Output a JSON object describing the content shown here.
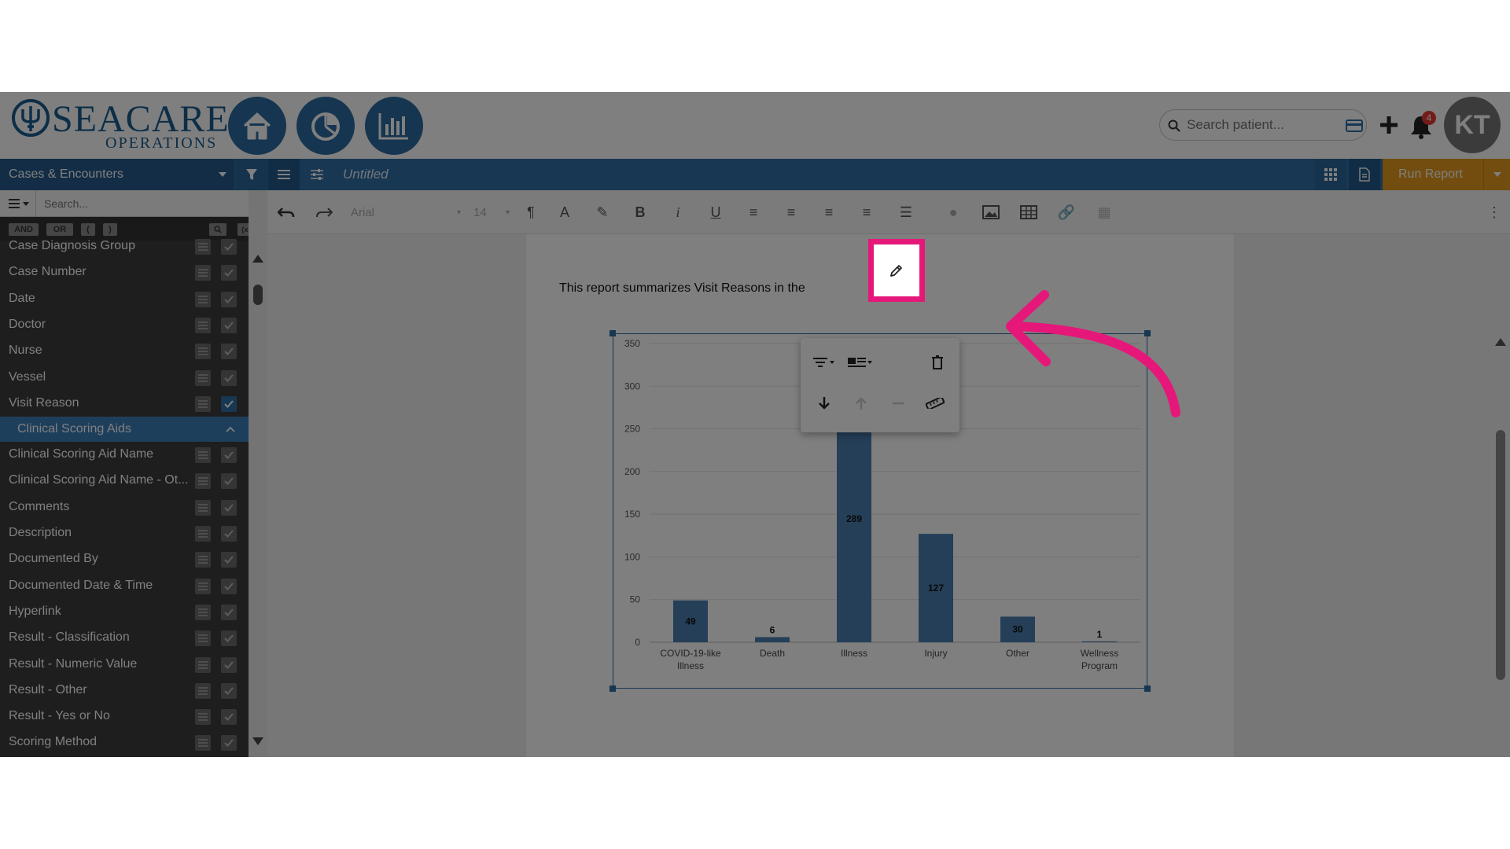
{
  "header": {
    "logo_main": "SEACARE",
    "logo_sub": "OPERATIONS",
    "nav": [
      "home-icon",
      "pie-chart-icon",
      "bar-chart-icon"
    ],
    "search_placeholder": "Search patient...",
    "notification_count": "4",
    "avatar_initials": "KT"
  },
  "toolbar": {
    "dataset_label": "Cases & Encounters",
    "document_title": "Untitled",
    "run_report_label": "Run Report",
    "font_name": "Arial",
    "font_size": "14"
  },
  "sidebar": {
    "search_placeholder": "Search...",
    "operators": [
      "AND",
      "OR",
      "(",
      ")"
    ],
    "fields_top": [
      {
        "label": "Case Diagnosis Group",
        "checked": false
      },
      {
        "label": "Case Number",
        "checked": false
      },
      {
        "label": "Date",
        "checked": false
      },
      {
        "label": "Doctor",
        "checked": false
      },
      {
        "label": "Nurse",
        "checked": false
      },
      {
        "label": "Vessel",
        "checked": false
      },
      {
        "label": "Visit Reason",
        "checked": true
      }
    ],
    "section_label": "Clinical Scoring Aids",
    "fields_section": [
      {
        "label": "Clinical Scoring Aid Name",
        "checked": false
      },
      {
        "label": "Clinical Scoring Aid Name - Ot...",
        "checked": false
      },
      {
        "label": "Comments",
        "checked": false
      },
      {
        "label": "Description",
        "checked": false
      },
      {
        "label": "Documented By",
        "checked": false
      },
      {
        "label": "Documented Date & Time",
        "checked": false
      },
      {
        "label": "Hyperlink",
        "checked": false
      },
      {
        "label": "Result - Classification",
        "checked": false
      },
      {
        "label": "Result - Numeric Value",
        "checked": false
      },
      {
        "label": "Result - Other",
        "checked": false
      },
      {
        "label": "Result - Yes or No",
        "checked": false
      },
      {
        "label": "Scoring Method",
        "checked": false
      }
    ]
  },
  "document": {
    "intro_text": "This report summarizes Visit Reasons in the"
  },
  "chart_data": {
    "type": "bar",
    "categories": [
      "COVID-19-like Illness",
      "Death",
      "Illness",
      "Injury",
      "Other",
      "Wellness Program"
    ],
    "category_lines": [
      [
        "COVID-19-like",
        "Illness"
      ],
      [
        "Death"
      ],
      [
        "Illness"
      ],
      [
        "Injury"
      ],
      [
        "Other"
      ],
      [
        "Wellness",
        "Program"
      ]
    ],
    "values": [
      49,
      6,
      289,
      127,
      30,
      1
    ],
    "title": "",
    "xlabel": "",
    "ylabel": "",
    "ylim": [
      0,
      350
    ],
    "yticks": [
      0,
      50,
      100,
      150,
      200,
      250,
      300,
      350
    ],
    "grid": true,
    "bar_color": "#4a7eb0"
  },
  "colors": {
    "brand_blue": "#2e6fa7",
    "run_report": "#e59b1f",
    "highlight": "#e5187a",
    "notification": "#e53935"
  }
}
